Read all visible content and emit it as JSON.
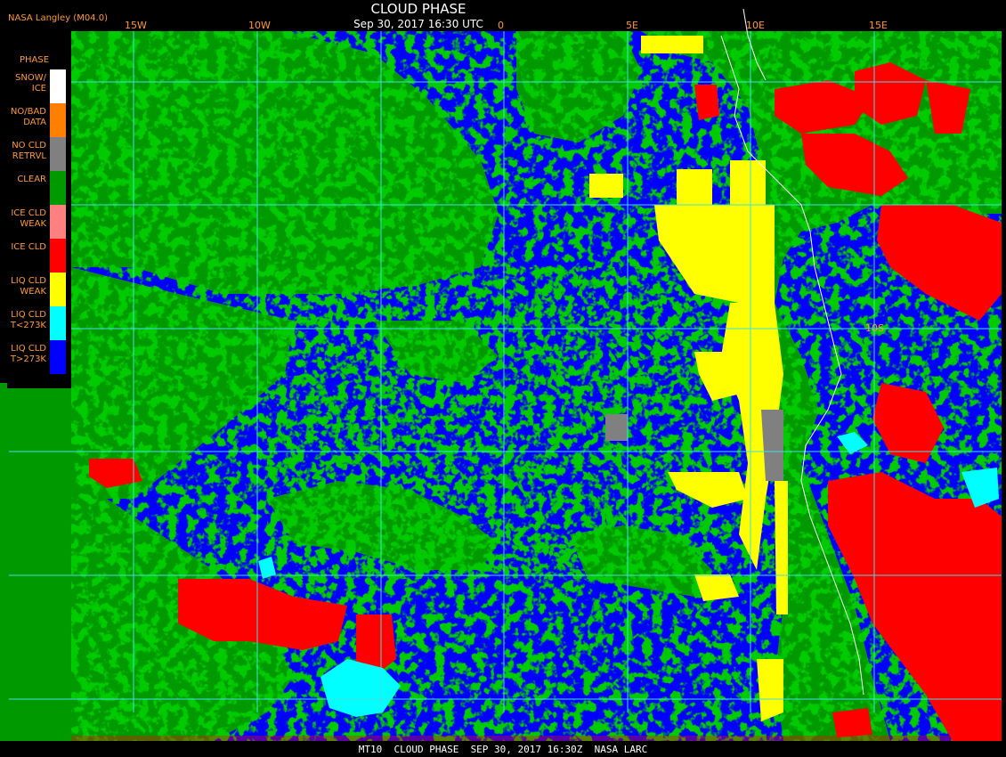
{
  "header": {
    "title": "CLOUD PHASE",
    "subtitle": "Sep 30, 2017 16:30 UTC",
    "producer": "NASA Langley (M04.0)"
  },
  "longitude_labels": [
    "15W",
    "10W",
    "0",
    "5E",
    "10E",
    "15E"
  ],
  "latitude_labels": [
    "10S"
  ],
  "legend": {
    "title": "PHASE",
    "items": [
      {
        "label": "SNOW/\nICE",
        "color": "#ffffff"
      },
      {
        "label": "NO/BAD\nDATA",
        "color": "#ff8000"
      },
      {
        "label": "NO CLD\nRETRVL",
        "color": "#808080"
      },
      {
        "label": "CLEAR",
        "color": "#009900"
      },
      {
        "label": "ICE CLD\nWEAK",
        "color": "#ff8080"
      },
      {
        "label": "ICE CLD",
        "color": "#ff0000"
      },
      {
        "label": "LIQ CLD\nWEAK",
        "color": "#ffff00"
      },
      {
        "label": "LIQ CLD\nT<273K",
        "color": "#00ffff"
      },
      {
        "label": "LIQ CLD\nT>273K",
        "color": "#0000ff"
      }
    ]
  },
  "footer": "MT10  CLOUD PHASE  SEP 30, 2017 16:30Z  NASA LARC",
  "colors": {
    "grid": "#40e0e0",
    "label": "#ff9933",
    "background": "#000000"
  }
}
